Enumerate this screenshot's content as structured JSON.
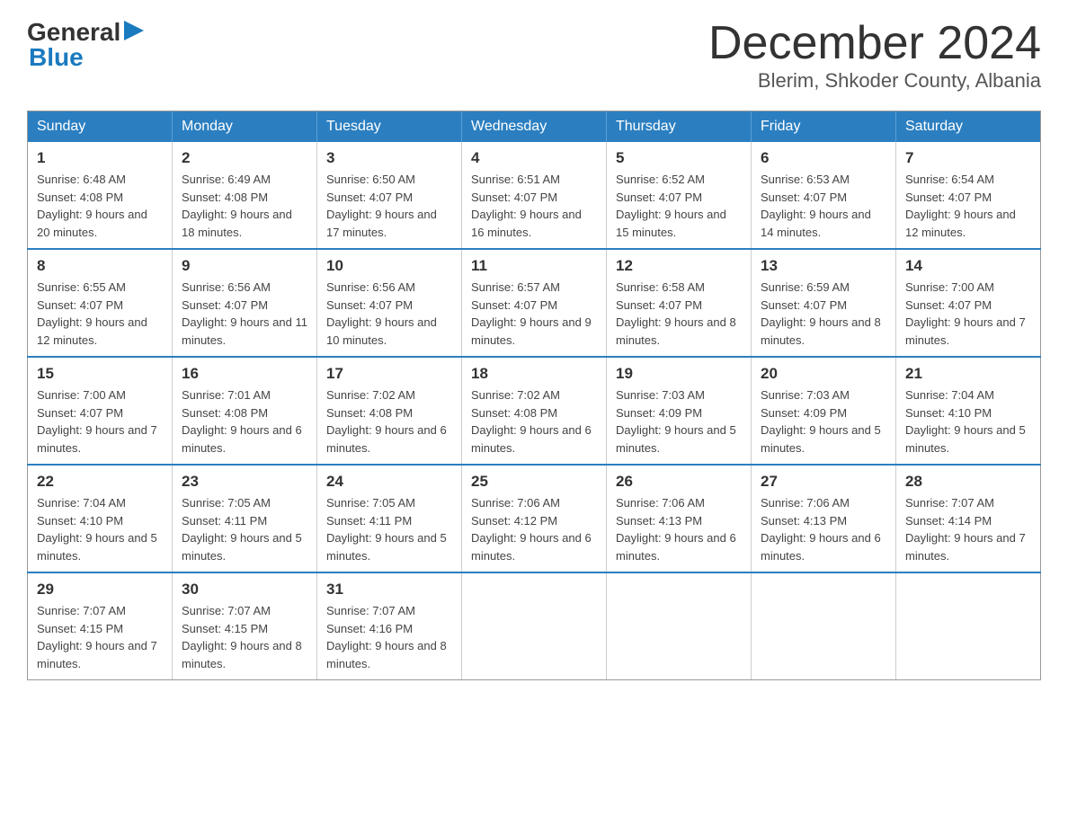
{
  "header": {
    "logo": {
      "general": "General",
      "blue": "Blue"
    },
    "title": "December 2024",
    "subtitle": "Blerim, Shkoder County, Albania"
  },
  "calendar": {
    "headers": [
      "Sunday",
      "Monday",
      "Tuesday",
      "Wednesday",
      "Thursday",
      "Friday",
      "Saturday"
    ],
    "weeks": [
      [
        {
          "day": "1",
          "sunrise": "6:48 AM",
          "sunset": "4:08 PM",
          "daylight": "9 hours and 20 minutes."
        },
        {
          "day": "2",
          "sunrise": "6:49 AM",
          "sunset": "4:08 PM",
          "daylight": "9 hours and 18 minutes."
        },
        {
          "day": "3",
          "sunrise": "6:50 AM",
          "sunset": "4:07 PM",
          "daylight": "9 hours and 17 minutes."
        },
        {
          "day": "4",
          "sunrise": "6:51 AM",
          "sunset": "4:07 PM",
          "daylight": "9 hours and 16 minutes."
        },
        {
          "day": "5",
          "sunrise": "6:52 AM",
          "sunset": "4:07 PM",
          "daylight": "9 hours and 15 minutes."
        },
        {
          "day": "6",
          "sunrise": "6:53 AM",
          "sunset": "4:07 PM",
          "daylight": "9 hours and 14 minutes."
        },
        {
          "day": "7",
          "sunrise": "6:54 AM",
          "sunset": "4:07 PM",
          "daylight": "9 hours and 12 minutes."
        }
      ],
      [
        {
          "day": "8",
          "sunrise": "6:55 AM",
          "sunset": "4:07 PM",
          "daylight": "9 hours and 12 minutes."
        },
        {
          "day": "9",
          "sunrise": "6:56 AM",
          "sunset": "4:07 PM",
          "daylight": "9 hours and 11 minutes."
        },
        {
          "day": "10",
          "sunrise": "6:56 AM",
          "sunset": "4:07 PM",
          "daylight": "9 hours and 10 minutes."
        },
        {
          "day": "11",
          "sunrise": "6:57 AM",
          "sunset": "4:07 PM",
          "daylight": "9 hours and 9 minutes."
        },
        {
          "day": "12",
          "sunrise": "6:58 AM",
          "sunset": "4:07 PM",
          "daylight": "9 hours and 8 minutes."
        },
        {
          "day": "13",
          "sunrise": "6:59 AM",
          "sunset": "4:07 PM",
          "daylight": "9 hours and 8 minutes."
        },
        {
          "day": "14",
          "sunrise": "7:00 AM",
          "sunset": "4:07 PM",
          "daylight": "9 hours and 7 minutes."
        }
      ],
      [
        {
          "day": "15",
          "sunrise": "7:00 AM",
          "sunset": "4:07 PM",
          "daylight": "9 hours and 7 minutes."
        },
        {
          "day": "16",
          "sunrise": "7:01 AM",
          "sunset": "4:08 PM",
          "daylight": "9 hours and 6 minutes."
        },
        {
          "day": "17",
          "sunrise": "7:02 AM",
          "sunset": "4:08 PM",
          "daylight": "9 hours and 6 minutes."
        },
        {
          "day": "18",
          "sunrise": "7:02 AM",
          "sunset": "4:08 PM",
          "daylight": "9 hours and 6 minutes."
        },
        {
          "day": "19",
          "sunrise": "7:03 AM",
          "sunset": "4:09 PM",
          "daylight": "9 hours and 5 minutes."
        },
        {
          "day": "20",
          "sunrise": "7:03 AM",
          "sunset": "4:09 PM",
          "daylight": "9 hours and 5 minutes."
        },
        {
          "day": "21",
          "sunrise": "7:04 AM",
          "sunset": "4:10 PM",
          "daylight": "9 hours and 5 minutes."
        }
      ],
      [
        {
          "day": "22",
          "sunrise": "7:04 AM",
          "sunset": "4:10 PM",
          "daylight": "9 hours and 5 minutes."
        },
        {
          "day": "23",
          "sunrise": "7:05 AM",
          "sunset": "4:11 PM",
          "daylight": "9 hours and 5 minutes."
        },
        {
          "day": "24",
          "sunrise": "7:05 AM",
          "sunset": "4:11 PM",
          "daylight": "9 hours and 5 minutes."
        },
        {
          "day": "25",
          "sunrise": "7:06 AM",
          "sunset": "4:12 PM",
          "daylight": "9 hours and 6 minutes."
        },
        {
          "day": "26",
          "sunrise": "7:06 AM",
          "sunset": "4:13 PM",
          "daylight": "9 hours and 6 minutes."
        },
        {
          "day": "27",
          "sunrise": "7:06 AM",
          "sunset": "4:13 PM",
          "daylight": "9 hours and 6 minutes."
        },
        {
          "day": "28",
          "sunrise": "7:07 AM",
          "sunset": "4:14 PM",
          "daylight": "9 hours and 7 minutes."
        }
      ],
      [
        {
          "day": "29",
          "sunrise": "7:07 AM",
          "sunset": "4:15 PM",
          "daylight": "9 hours and 7 minutes."
        },
        {
          "day": "30",
          "sunrise": "7:07 AM",
          "sunset": "4:15 PM",
          "daylight": "9 hours and 8 minutes."
        },
        {
          "day": "31",
          "sunrise": "7:07 AM",
          "sunset": "4:16 PM",
          "daylight": "9 hours and 8 minutes."
        },
        null,
        null,
        null,
        null
      ]
    ]
  }
}
